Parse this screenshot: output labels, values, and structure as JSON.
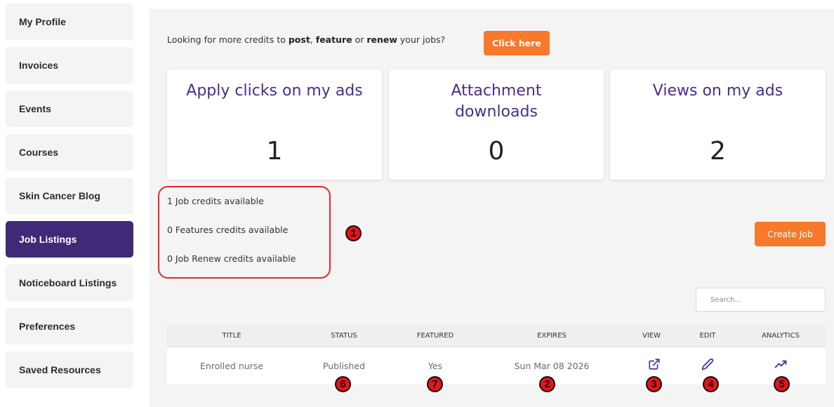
{
  "sidebar": {
    "items": [
      {
        "label": "My Profile"
      },
      {
        "label": "Invoices"
      },
      {
        "label": "Events"
      },
      {
        "label": "Courses"
      },
      {
        "label": "Skin Cancer Blog"
      },
      {
        "label": "Job Listings",
        "active": true
      },
      {
        "label": "Noticeboard Listings"
      },
      {
        "label": "Preferences"
      },
      {
        "label": "Saved Resources"
      }
    ]
  },
  "promo": {
    "text_1": "Looking for more credits to ",
    "bold_post": "post",
    "text_2": ", ",
    "bold_feature": "feature",
    "text_3": " or ",
    "bold_renew": "renew",
    "text_4": " your jobs?",
    "button_label": "Click here"
  },
  "stats": [
    {
      "title": "Apply clicks on my ads",
      "value": "1"
    },
    {
      "title": "Attachment downloads",
      "value": "0"
    },
    {
      "title": "Views on my ads",
      "value": "2"
    }
  ],
  "credits": [
    "1 Job credits available",
    "0 Features credits available",
    "0 Job Renew credits available"
  ],
  "create_job_label": "Create Job",
  "search": {
    "placeholder": "Search..."
  },
  "table": {
    "headers": [
      "TITLE",
      "STATUS",
      "FEATURED",
      "EXPIRES",
      "VIEW",
      "EDIT",
      "ANALYTICS"
    ],
    "rows": [
      {
        "title": "Enrolled nurse",
        "status": "Published",
        "featured": "Yes",
        "expires": "Sun Mar 08 2026"
      }
    ]
  },
  "annotations": [
    "1",
    "2",
    "3",
    "4",
    "5",
    "6",
    "7"
  ],
  "colors": {
    "accent_purple": "#3f2a78",
    "stat_title_purple": "#4a2d8c",
    "orange": "#f7792b",
    "annotation_red": "#e4141a"
  },
  "icons": {
    "view": "external-link-icon",
    "edit": "pencil-icon",
    "analytics": "trending-up-icon"
  }
}
